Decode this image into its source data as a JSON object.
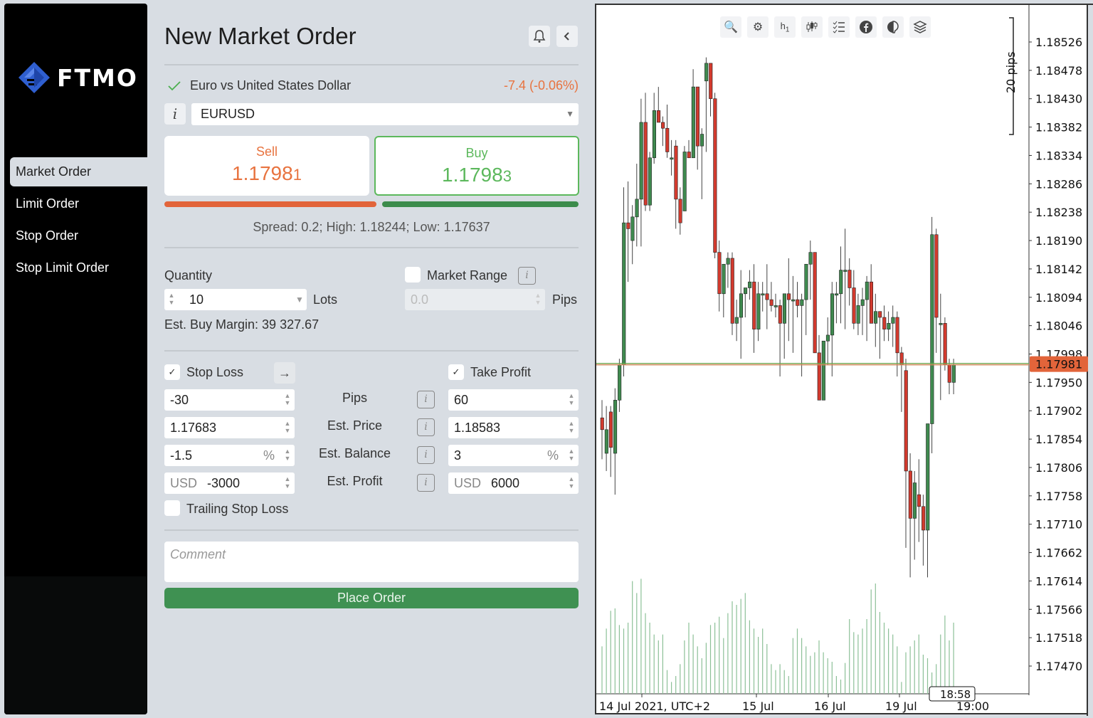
{
  "brand": {
    "name": "FTMO",
    "logo_color": "#2f5fd0"
  },
  "sidebar": {
    "items": [
      {
        "label": "Market Order",
        "active": true
      },
      {
        "label": "Limit Order",
        "active": false
      },
      {
        "label": "Stop Order",
        "active": false
      },
      {
        "label": "Stop Limit Order",
        "active": false
      }
    ]
  },
  "header": {
    "title": "New Market Order",
    "bell_icon": "bell-icon",
    "collapse_icon": "chevron-left-icon"
  },
  "symbol": {
    "description": "Euro vs United States Dollar",
    "change": "-7.4 (-0.06%)",
    "selected": "EURUSD"
  },
  "quote": {
    "sell_label": "Sell",
    "sell_main": "1.1798",
    "sell_pip": "1",
    "buy_label": "Buy",
    "buy_main": "1.1798",
    "buy_pip": "3",
    "spread_text": "Spread: 0.2; High: 1.18244; Low: 1.17637",
    "sell_color": "#e8733f",
    "buy_color": "#5cb85c"
  },
  "quantity": {
    "label": "Quantity",
    "value": "10",
    "unit": "Lots",
    "margin_text": "Est. Buy Margin: 39 327.67"
  },
  "market_range": {
    "label": "Market Range",
    "checked": false,
    "placeholder": "0.0",
    "unit": "Pips"
  },
  "stop_loss": {
    "label": "Stop Loss",
    "checked": true,
    "pips": "-30",
    "price": "1.17683",
    "balance": "-1.5",
    "balance_unit": "%",
    "profit_currency": "USD",
    "profit": "-3000"
  },
  "take_profit": {
    "label": "Take Profit",
    "checked": true,
    "pips": "60",
    "price": "1.18583",
    "balance": "3",
    "balance_unit": "%",
    "profit_currency": "USD",
    "profit": "6000"
  },
  "row_labels": [
    "Pips",
    "Est. Price",
    "Est. Balance",
    "Est. Profit"
  ],
  "trailing_stop": {
    "label": "Trailing Stop Loss",
    "checked": false
  },
  "comment": {
    "placeholder": "Comment"
  },
  "place_order_label": "Place Order",
  "chart_toolbar": [
    "zoom-in-icon",
    "chart-settings-icon",
    "timeframe-h1",
    "candlestick-icon",
    "checklist-icon",
    "facebook-icon",
    "theme-icon",
    "layers-icon"
  ],
  "timeframe": {
    "main": "h",
    "sub": "1"
  },
  "chart_data": {
    "type": "candlestick",
    "symbol": "EURUSD",
    "timeframe": "H1",
    "y_ticks": [
      "1.18526",
      "1.18478",
      "1.18430",
      "1.18382",
      "1.18334",
      "1.18286",
      "1.18238",
      "1.18190",
      "1.18142",
      "1.18094",
      "1.18046",
      "1.17998",
      "1.17950",
      "1.17902",
      "1.17854",
      "1.17806",
      "1.17758",
      "1.17710",
      "1.17662",
      "1.17614",
      "1.17566",
      "1.17518",
      "1.17470"
    ],
    "ylim": [
      1.1744,
      1.1856
    ],
    "x_ticks": [
      "14 Jul 2021, UTC+2",
      "15 Jul",
      "16 Jul",
      "19 Jul",
      "19:00"
    ],
    "current_price": "1.17981",
    "crosshair_time": "18:58",
    "scale_marker": "20 pips",
    "candles": [
      [
        1.1789,
        1.1792,
        1.1782,
        1.1787
      ],
      [
        1.1783,
        1.1791,
        1.178,
        1.1787
      ],
      [
        1.179,
        1.1791,
        1.1779,
        1.1784
      ],
      [
        1.1783,
        1.1794,
        1.1776,
        1.1792
      ],
      [
        1.1792,
        1.1799,
        1.179,
        1.1798
      ],
      [
        1.1798,
        1.1828,
        1.1796,
        1.1822
      ],
      [
        1.1822,
        1.1829,
        1.1812,
        1.1821
      ],
      [
        1.1819,
        1.1825,
        1.1815,
        1.1823
      ],
      [
        1.1823,
        1.1832,
        1.1818,
        1.1826
      ],
      [
        1.1826,
        1.1843,
        1.1818,
        1.1839
      ],
      [
        1.1839,
        1.1844,
        1.1824,
        1.1825
      ],
      [
        1.1825,
        1.1834,
        1.1824,
        1.1833
      ],
      [
        1.1833,
        1.1844,
        1.1832,
        1.1841
      ],
      [
        1.1841,
        1.1845,
        1.1839,
        1.1839
      ],
      [
        1.1839,
        1.184,
        1.1835,
        1.1838
      ],
      [
        1.1838,
        1.1842,
        1.1833,
        1.1834
      ],
      [
        1.1833,
        1.1836,
        1.183,
        1.1833
      ],
      [
        1.1835,
        1.1836,
        1.1821,
        1.1826
      ],
      [
        1.1826,
        1.1828,
        1.182,
        1.1822
      ],
      [
        1.1824,
        1.1835,
        1.1824,
        1.1834
      ],
      [
        1.1834,
        1.1836,
        1.1833,
        1.1833
      ],
      [
        1.1833,
        1.1848,
        1.1833,
        1.1845
      ],
      [
        1.1845,
        1.1842,
        1.1831,
        1.1835
      ],
      [
        1.1835,
        1.1838,
        1.1826,
        1.1837
      ],
      [
        1.1846,
        1.185,
        1.1834,
        1.1849
      ],
      [
        1.1849,
        1.1847,
        1.184,
        1.1843
      ],
      [
        1.1843,
        1.1844,
        1.1816,
        1.1817
      ],
      [
        1.1817,
        1.1819,
        1.1807,
        1.181
      ],
      [
        1.181,
        1.1815,
        1.1806,
        1.1815
      ],
      [
        1.1815,
        1.1817,
        1.1811,
        1.1816
      ],
      [
        1.1816,
        1.1817,
        1.1803,
        1.1805
      ],
      [
        1.1805,
        1.1809,
        1.1802,
        1.1806
      ],
      [
        1.1806,
        1.1814,
        1.1799,
        1.181
      ],
      [
        1.181,
        1.1811,
        1.1806,
        1.1811
      ],
      [
        1.1811,
        1.1814,
        1.1809,
        1.1812
      ],
      [
        1.1812,
        1.1815,
        1.18,
        1.1804
      ],
      [
        1.1804,
        1.1812,
        1.1802,
        1.181
      ],
      [
        1.181,
        1.1812,
        1.1807,
        1.181
      ],
      [
        1.181,
        1.1815,
        1.1804,
        1.1809
      ],
      [
        1.1809,
        1.1812,
        1.1807,
        1.1808
      ],
      [
        1.1808,
        1.181,
        1.1806,
        1.1808
      ],
      [
        1.1808,
        1.1809,
        1.1796,
        1.1805
      ],
      [
        1.1805,
        1.181,
        1.1799,
        1.181
      ],
      [
        1.181,
        1.1816,
        1.1802,
        1.1809
      ],
      [
        1.1809,
        1.1813,
        1.18,
        1.1809
      ],
      [
        1.1809,
        1.1812,
        1.1806,
        1.1808
      ],
      [
        1.1808,
        1.181,
        1.1796,
        1.1809
      ],
      [
        1.1809,
        1.1814,
        1.1803,
        1.1815
      ],
      [
        1.1815,
        1.1819,
        1.1809,
        1.1817
      ],
      [
        1.1817,
        1.1817,
        1.1801,
        1.18
      ],
      [
        1.18,
        1.1803,
        1.1792,
        1.1792
      ],
      [
        1.1792,
        1.1802,
        1.1793,
        1.1802
      ],
      [
        1.1802,
        1.1806,
        1.1798,
        1.1803
      ],
      [
        1.1803,
        1.1812,
        1.1796,
        1.181
      ],
      [
        1.181,
        1.1812,
        1.1805,
        1.181
      ],
      [
        1.181,
        1.1818,
        1.1805,
        1.1814
      ],
      [
        1.1814,
        1.1821,
        1.1804,
        1.1814
      ],
      [
        1.1814,
        1.1816,
        1.1808,
        1.1811
      ],
      [
        1.1811,
        1.1814,
        1.1804,
        1.1805
      ],
      [
        1.1805,
        1.181,
        1.1803,
        1.1808
      ],
      [
        1.1808,
        1.1811,
        1.1803,
        1.1809
      ],
      [
        1.1809,
        1.1813,
        1.1802,
        1.1812
      ],
      [
        1.1812,
        1.1815,
        1.1806,
        1.1805
      ],
      [
        1.1805,
        1.181,
        1.1801,
        1.1807
      ],
      [
        1.1807,
        1.1807,
        1.1799,
        1.1806
      ],
      [
        1.1806,
        1.1808,
        1.1802,
        1.1804
      ],
      [
        1.1804,
        1.1807,
        1.1802,
        1.1805
      ],
      [
        1.1805,
        1.1808,
        1.1801,
        1.1806
      ],
      [
        1.1806,
        1.1807,
        1.1796,
        1.18
      ],
      [
        1.18,
        1.1801,
        1.179,
        1.1798
      ],
      [
        1.1797,
        1.1799,
        1.1767,
        1.178
      ],
      [
        1.178,
        1.1783,
        1.1762,
        1.1772
      ],
      [
        1.1772,
        1.178,
        1.1765,
        1.1778
      ],
      [
        1.1776,
        1.1782,
        1.1768,
        1.1774
      ],
      [
        1.1774,
        1.1776,
        1.1764,
        1.177
      ],
      [
        1.177,
        1.1788,
        1.1762,
        1.1788
      ],
      [
        1.1788,
        1.1823,
        1.1783,
        1.182
      ],
      [
        1.182,
        1.1821,
        1.18,
        1.1806
      ],
      [
        1.1805,
        1.181,
        1.1792,
        1.1805
      ],
      [
        1.1805,
        1.1806,
        1.1797,
        1.1798
      ],
      [
        1.1798,
        1.1799,
        1.1793,
        1.1795
      ],
      [
        1.1795,
        1.1799,
        1.1793,
        1.1798
      ]
    ],
    "volumes": [
      40,
      55,
      70,
      72,
      58,
      55,
      60,
      95,
      85,
      97,
      68,
      60,
      50,
      45,
      50,
      20,
      10,
      15,
      25,
      45,
      60,
      50,
      40,
      30,
      43,
      58,
      60,
      65,
      47,
      68,
      78,
      75,
      80,
      85,
      62,
      55,
      48,
      55,
      42,
      25,
      20,
      25,
      20,
      15,
      47,
      55,
      47,
      40,
      32,
      35,
      45,
      35,
      30,
      27,
      15,
      12,
      26,
      63,
      52,
      50,
      55,
      63,
      88,
      93,
      69,
      60,
      55,
      50,
      40,
      10,
      35,
      40,
      45,
      50,
      33,
      30,
      18,
      25,
      50,
      66,
      45,
      60,
      63,
      85,
      100,
      105,
      90,
      65,
      60,
      35
    ]
  }
}
